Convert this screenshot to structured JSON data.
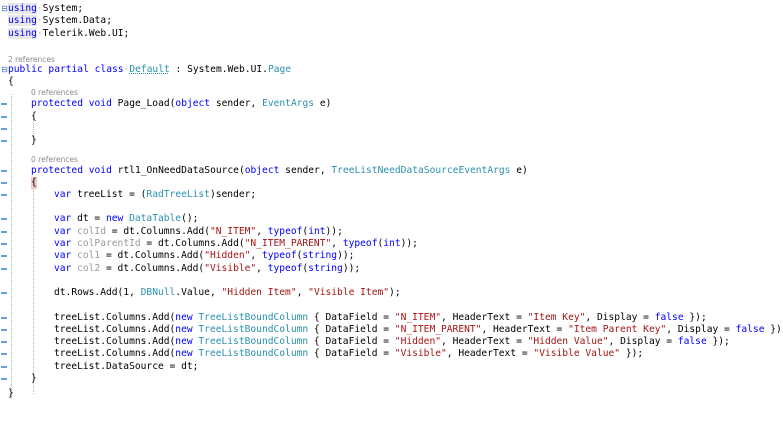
{
  "colors": {
    "keyword": "#0000ff",
    "type": "#2b91af",
    "string": "#a31515",
    "text": "#000000",
    "lens": "#8a8a8a"
  },
  "icons": {
    "fold": "collapse-bracket-icon",
    "marker": "margin-marker-icon"
  },
  "code": {
    "using1_kw": "using",
    "using1_ns": "System;",
    "using2_kw": "using",
    "using2_ns": "System.Data;",
    "using3_kw": "using",
    "using3_ns": "Telerik.Web.UI;",
    "lens_class": "2 references",
    "class_kw": "public partial class",
    "class_name": "Default",
    "class_sep": " : System.Web.UI.",
    "class_base": "Page",
    "brace_open": "{",
    "brace_close": "}",
    "lens_pageload": "0 references",
    "pl_kw": "protected void",
    "pl_name": " Page_Load(",
    "pl_obj": "object",
    "pl_sender": " sender, ",
    "pl_args": "EventArgs",
    "pl_e": " e)",
    "lens_needds": "0 references",
    "nd_kw": "protected void",
    "nd_name": " rtl1_OnNeedDataSource(",
    "nd_obj": "object",
    "nd_sender": " sender, ",
    "nd_args": "TreeListNeedDataSourceEventArgs",
    "nd_e": " e)",
    "var": "var",
    "tl_decl": " treeList = (",
    "tl_type": "RadTreeList",
    "tl_end": ")sender;",
    "dt_decl": " dt = ",
    "new": "new",
    "dt_type": "DataTable",
    "dt_end": "();",
    "colId_name": "colId",
    "colParentId_name": "colParentId",
    "col1_name": "col1",
    "col2_name": "col2",
    "cols_add": " = dt.Columns.Add(",
    "s_nitem": "\"N_ITEM\"",
    "s_nitemparent": "\"N_ITEM_PARENT\"",
    "s_hidden": "\"Hidden\"",
    "s_visible": "\"Visible\"",
    "typeof": "typeof",
    "int": "int",
    "string": "string",
    "typeof_end": "));",
    "comma_sp": ", ",
    "paren_open": "(",
    "rows_add": "dt.Rows.Add(1, ",
    "dbnull": "DBNull",
    "dbnull_value": ".Value, ",
    "s_hidden_item": "\"Hidden Item\"",
    "s_visible_item": "\"Visible Item\"",
    "rows_end": ");",
    "tl_cols_add": "treeList.Columns.Add(",
    "bound_col": "TreeListBoundColumn",
    "df_open": " { DataField = ",
    "ht": ", HeaderText = ",
    "disp": ", Display = ",
    "false": "false",
    "close_obj": " });",
    "s_item_key": "\"Item Key\"",
    "s_item_parent_key": "\"Item Parent Key\"",
    "s_hidden_value": "\"Hidden Value\"",
    "s_visible_value": "\"Visible Value\"",
    "ds_assign": "treeList.DataSource = dt;"
  }
}
